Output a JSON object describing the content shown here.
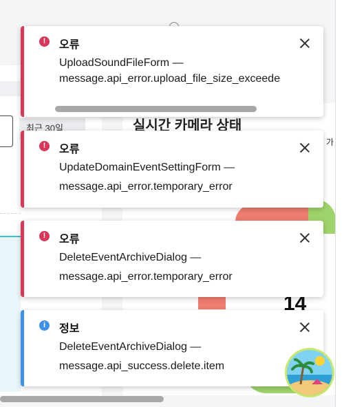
{
  "background": {
    "chip_text": "최근 30일",
    "section_title": "실시간 카메라 상태",
    "right_edge_text": "가",
    "big_number": "14"
  },
  "toasts": [
    {
      "type": "error",
      "icon": "exclamation-icon",
      "title": "오류",
      "source": "UploadSoundFileForm —",
      "message": "message.api_error.upload_file_size_exceeded"
    },
    {
      "type": "error",
      "icon": "exclamation-icon",
      "title": "오류",
      "source": "UpdateDomainEventSettingForm —",
      "message": "message.api_error.temporary_error"
    },
    {
      "type": "error",
      "icon": "exclamation-icon",
      "title": "오류",
      "source": "DeleteEventArchiveDialog —",
      "message": "message.api_error.temporary_error"
    },
    {
      "type": "info",
      "icon": "info-icon",
      "title": "정보",
      "source": "DeleteEventArchiveDialog —",
      "message": "message.api_success.delete.item"
    }
  ],
  "colors": {
    "error": "#d8375a",
    "info": "#3d8fe8"
  }
}
